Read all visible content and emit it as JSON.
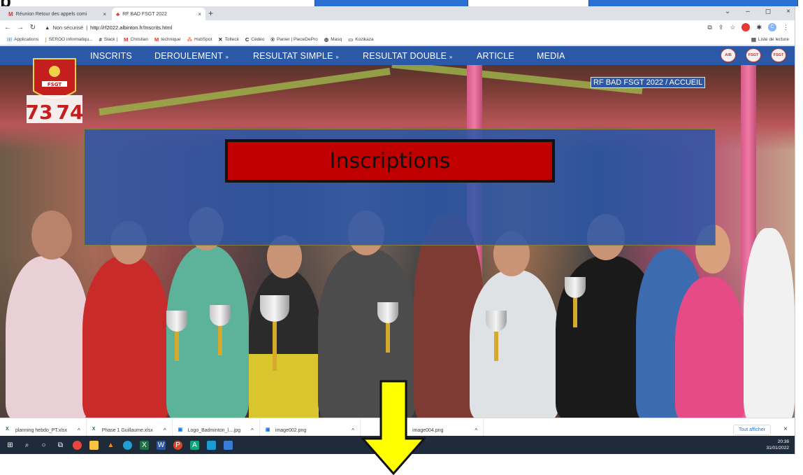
{
  "slide": {
    "partial_text": "p"
  },
  "browser": {
    "tabs": [
      {
        "label": "Réunion Retour des appels comi",
        "close": "×"
      },
      {
        "label": "RF BAD FSGT 2022",
        "close": "×"
      }
    ],
    "new_tab": "+",
    "window_controls": [
      "⌄",
      "–",
      "◻",
      "×"
    ],
    "address": {
      "security": "Non sécurisé",
      "url": "http://rf2022.albinton.fr/Inscrits.html"
    },
    "bookmarks": [
      {
        "label": "Applications",
        "icon": "apps-grid-icon"
      },
      {
        "label": "SEROO informatiqu...",
        "icon": "seroo-icon"
      },
      {
        "label": "Slack |",
        "icon": "slack-icon"
      },
      {
        "label": "Christian",
        "icon": "gmail-icon"
      },
      {
        "label": "technique",
        "icon": "gmail-icon"
      },
      {
        "label": "HubSpot",
        "icon": "hubspot-icon"
      },
      {
        "label": "Tolteck",
        "icon": "tolteck-icon"
      },
      {
        "label": "Cédéo",
        "icon": "cedeo-icon"
      },
      {
        "label": "Panier | PieceDePro",
        "icon": "piecedepro-icon"
      },
      {
        "label": "Masq",
        "icon": "globe-icon"
      },
      {
        "label": "Kozikaza",
        "icon": "kozikaza-icon"
      }
    ],
    "reading_list": "Liste de lecture",
    "avatar_letter": "C"
  },
  "site": {
    "nav": [
      "INSCRITS",
      "DEROULEMENT",
      "RESULTAT SIMPLE",
      "RESULTAT DOUBLE",
      "ARTICLE",
      "MEDIA"
    ],
    "nav_dropdown_marker": "»",
    "breadcrumb": "RF BAD FSGT 2022 / ACCUEIL",
    "title": "Inscriptions",
    "logo_text": "FSGT",
    "logo_numbers": [
      "73",
      "74"
    ],
    "partner_logos": [
      "AlB",
      "FSGT",
      "FSGT"
    ]
  },
  "downloads": {
    "items": [
      {
        "name": "planning hebdo_PT.xlsx",
        "type": "excel"
      },
      {
        "name": "Phase 1 Guillaume.xlsx",
        "type": "excel"
      },
      {
        "name": "Logo_Badminton_l....jpg",
        "type": "image"
      },
      {
        "name": "image002.png",
        "type": "image"
      },
      {
        "name": "image004.png",
        "type": "image"
      }
    ],
    "show_all": "Tout afficher"
  },
  "taskbar": {
    "time": "20:38",
    "date": "31/01/2022"
  },
  "colors": {
    "site_blue": "#2c58a8",
    "title_red": "#c00000",
    "arrow_yellow": "#ffff00"
  }
}
